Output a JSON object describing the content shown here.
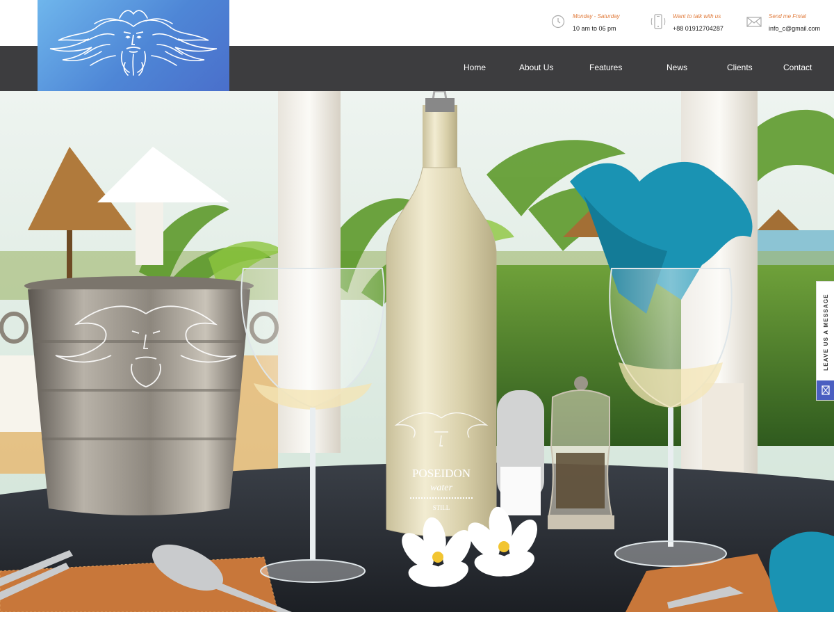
{
  "brand": {
    "logo_icon": "poseidon-face-icon",
    "logo_gradient": [
      "#6fb6ec",
      "#4a6fcb"
    ]
  },
  "contact": {
    "hours": {
      "label": "Monday - Saturday",
      "value": "10 am to 06 pm",
      "icon": "clock-icon"
    },
    "phone": {
      "label": "Want to talk with us",
      "value": "+88 01912704287",
      "icon": "phone-icon"
    },
    "email": {
      "label": "Send me Fmial",
      "value": "info_c@gmail.com",
      "icon": "envelope-icon"
    }
  },
  "nav": {
    "items": [
      {
        "label": "Home"
      },
      {
        "label": "About Us"
      },
      {
        "label": "Features"
      },
      {
        "label": "News"
      },
      {
        "label": "Clients"
      },
      {
        "label": "Contact"
      }
    ]
  },
  "hero": {
    "bottle": {
      "brand": "POSEIDON",
      "sub": "water",
      "type": "STILL"
    }
  },
  "sidetab": {
    "label": "LEAVE US A MESSAGE",
    "icon": "envelope-icon"
  },
  "colors": {
    "nav_bg": "#3d3d3f",
    "accent_orange": "#e07a3a",
    "side_button": "#4a5fc1",
    "napkin": "#1a93b3"
  }
}
